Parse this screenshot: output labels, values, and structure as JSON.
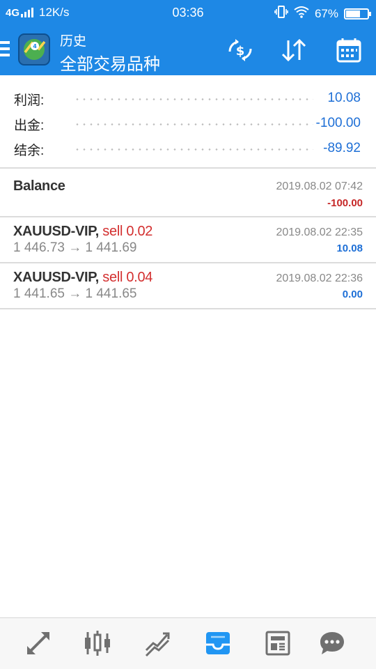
{
  "status_bar": {
    "network": "4G",
    "speed": "12K/s",
    "time": "03:36",
    "battery": "67%"
  },
  "app_bar": {
    "subtitle": "历史",
    "title": "全部交易品种",
    "icons": [
      "menu-icon",
      "app-logo-icon",
      "currency-exchange-icon",
      "sort-icon",
      "calendar-icon"
    ]
  },
  "summary": [
    {
      "label": "利润:",
      "value": "10.08"
    },
    {
      "label": "出金:",
      "value": "-100.00"
    },
    {
      "label": "结余:",
      "value": "-89.92"
    }
  ],
  "deals": [
    {
      "title": "Balance",
      "date": "2019.08.02 07:42",
      "profit": "-100.00"
    },
    {
      "symbol": "XAUUSD-VIP,",
      "action": "sell 0.02",
      "date": "2019.08.02 22:35",
      "prices": "1 446.73 → 1 441.69",
      "profit": "10.08"
    },
    {
      "symbol": "XAUUSD-VIP,",
      "action": "sell 0.04",
      "date": "2019.08.02 22:36",
      "prices": "1 441.65 → 1 441.65",
      "profit": "0.00"
    }
  ],
  "bottom_nav": {
    "items": [
      "quotes-arrows-icon",
      "candlestick-chart-icon",
      "trend-chart-icon",
      "history-inbox-icon",
      "news-icon",
      "chat-icon"
    ],
    "active": "history-inbox-icon"
  },
  "colors": {
    "primary": "#1e88e5",
    "positive": "#1e6fd6",
    "negative": "#c62828",
    "sell": "#d32f2f"
  }
}
